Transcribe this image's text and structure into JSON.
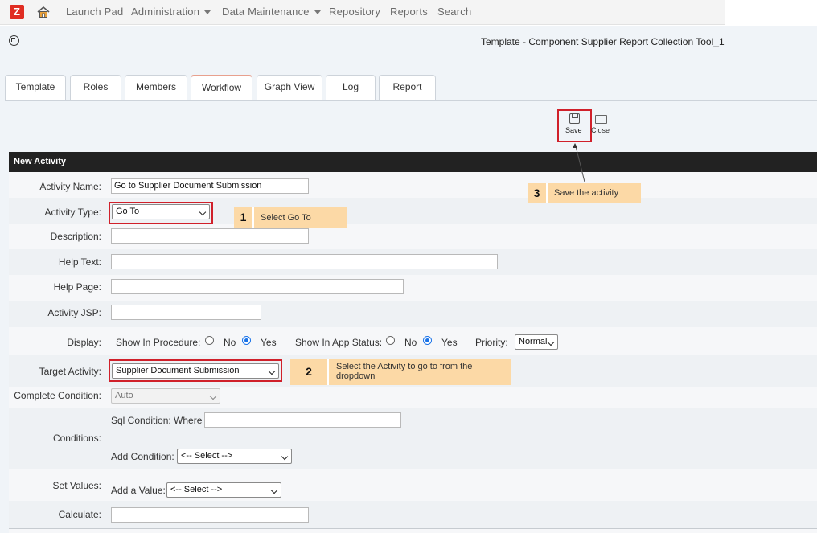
{
  "nav": {
    "logo": "Z",
    "items": [
      {
        "label": "Launch Pad",
        "dropdown": false
      },
      {
        "label": "Administration",
        "dropdown": true
      },
      {
        "label": "Data Maintenance",
        "dropdown": true
      },
      {
        "label": "Repository",
        "dropdown": false
      },
      {
        "label": "Reports",
        "dropdown": false
      },
      {
        "label": "Search",
        "dropdown": false
      }
    ]
  },
  "page": {
    "title": "Template - Component Supplier Report Collection Tool_1"
  },
  "tabs": [
    {
      "label": "Template"
    },
    {
      "label": "Roles"
    },
    {
      "label": "Members"
    },
    {
      "label": "Workflow",
      "active": true
    },
    {
      "label": "Graph View"
    },
    {
      "label": "Log"
    },
    {
      "label": "Report"
    }
  ],
  "toolbar": {
    "save_label": "Save",
    "close_label": "Close"
  },
  "section": {
    "title": "New Activity"
  },
  "form": {
    "activity_name": {
      "label": "Activity Name:",
      "value": "Go to Supplier Document Submission"
    },
    "activity_type": {
      "label": "Activity Type:",
      "value": "Go To"
    },
    "description": {
      "label": "Description:",
      "value": ""
    },
    "help_text": {
      "label": "Help Text:",
      "value": ""
    },
    "help_page": {
      "label": "Help Page:",
      "value": ""
    },
    "activity_jsp": {
      "label": "Activity JSP:",
      "value": ""
    },
    "display": {
      "label": "Display:",
      "show_in_procedure": "Show In Procedure:",
      "show_in_app_status": "Show In App Status:",
      "no": "No",
      "yes": "Yes",
      "priority_label": "Priority:",
      "priority_value": "Normal"
    },
    "target_activity": {
      "label": "Target Activity:",
      "value": "Supplier Document Submission"
    },
    "complete_condition": {
      "label": "Complete Condition:",
      "value": "Auto"
    },
    "conditions": {
      "label": "Conditions:",
      "sql_label": "Sql Condition: Where",
      "sql_value": "",
      "add_label": "Add Condition:",
      "add_value": "<-- Select -->"
    },
    "set_values": {
      "label": "Set Values:",
      "add_label": "Add a Value:",
      "add_value": "<-- Select -->"
    },
    "calculate": {
      "label": "Calculate:",
      "value": ""
    }
  },
  "callouts": [
    {
      "num": "1",
      "text": "Select Go To"
    },
    {
      "num": "2",
      "text": "Select the Activity to go to from the dropdown"
    },
    {
      "num": "3",
      "text": "Save the activity"
    }
  ],
  "colors": {
    "highlight": "#d0202a",
    "callout": "#fcd9a6",
    "header": "#222222",
    "logo": "#e02d22"
  }
}
